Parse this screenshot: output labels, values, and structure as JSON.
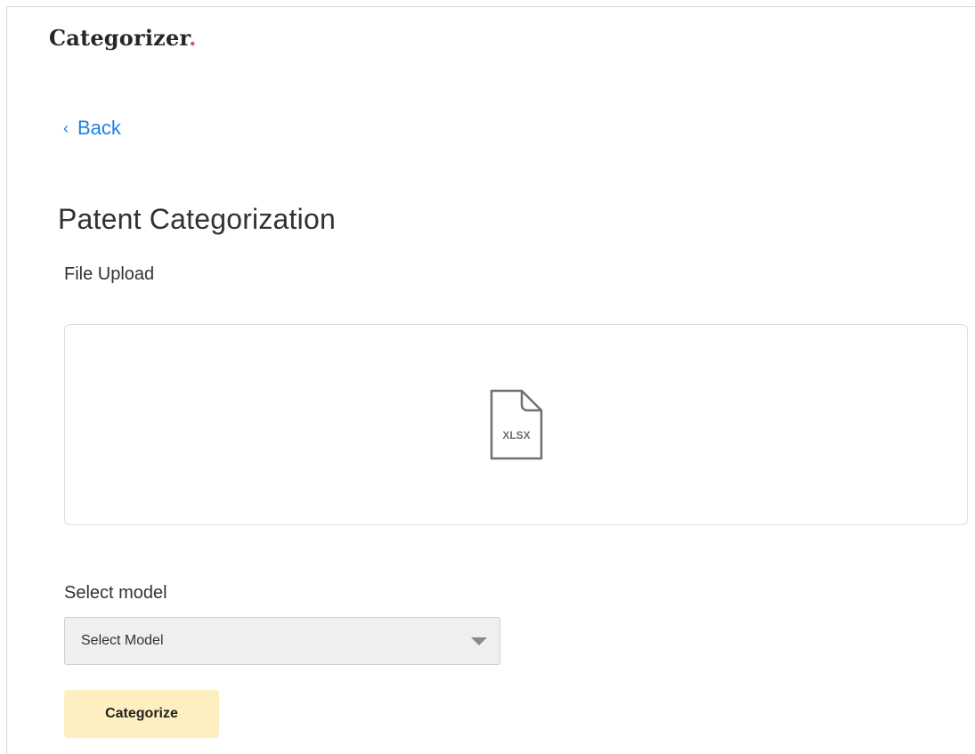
{
  "header": {
    "brand_name": "Categorizer",
    "brand_suffix": ".",
    "brand_accent_color": "#e0565c"
  },
  "navigation": {
    "back_icon": "chevron-left-icon",
    "back_label": "Back"
  },
  "main": {
    "title": "Patent Categorization",
    "upload": {
      "label": "File Upload",
      "file_icon": "xlsx-file-icon",
      "file_type_label": "XLSX"
    },
    "model_select": {
      "label": "Select model",
      "selected_value": "Select Model",
      "caret_icon": "caret-down-icon"
    },
    "action": {
      "categorize_label": "Categorize",
      "button_color": "#feefc1"
    },
    "link_color": "#1f7fe5"
  }
}
